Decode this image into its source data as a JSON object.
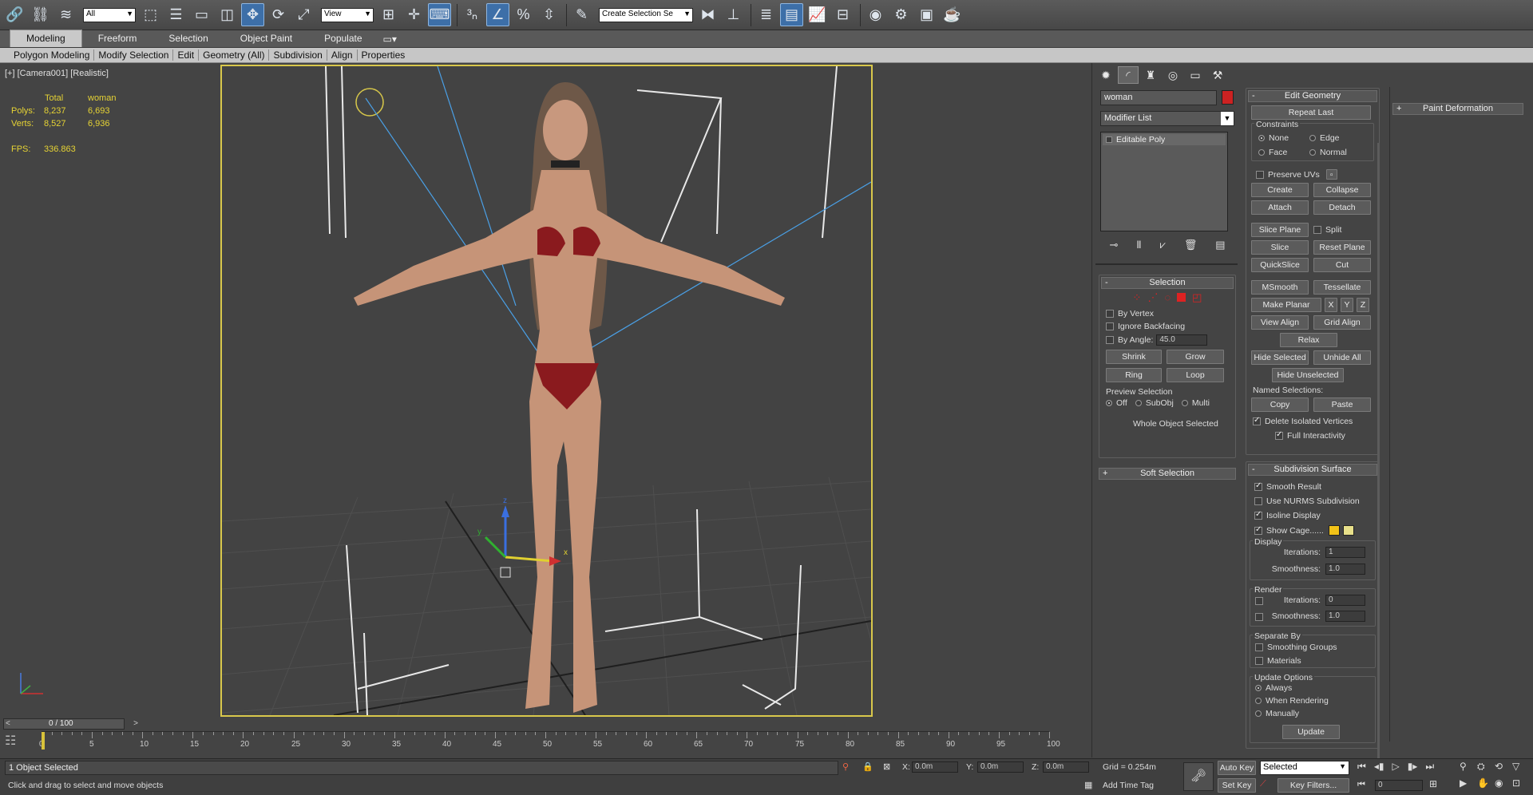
{
  "toolbar": {
    "selection_filter": "All",
    "ref_coord": "View",
    "named_selection_placeholder": "Create Selection Se",
    "icons": [
      "link-icon",
      "unlink-icon",
      "bind-spacewarp-icon",
      "select-object-icon",
      "select-by-name-icon",
      "rect-region-icon",
      "window-crossing-icon",
      "move-icon",
      "rotate-icon",
      "scale-icon",
      "pivot-icon",
      "snap-3d-icon",
      "angle-snap-icon",
      "percent-snap-icon",
      "spinner-snap-icon",
      "edit-named-sel-icon",
      "mirror-icon",
      "align-icon",
      "layers-icon",
      "ribbon-icon",
      "curve-editor-icon",
      "schematic-icon",
      "material-editor-icon",
      "render-setup-icon",
      "render-frame-icon",
      "render-icon"
    ]
  },
  "ribbon": {
    "tabs": [
      "Modeling",
      "Freeform",
      "Selection",
      "Object Paint",
      "Populate"
    ],
    "active_tab": "Modeling",
    "subbar": [
      "Polygon Modeling",
      "Modify Selection",
      "Edit",
      "Geometry (All)",
      "Subdivision",
      "Align",
      "Properties"
    ]
  },
  "viewport": {
    "label": "[+] [Camera001] [Realistic]",
    "stats": {
      "header_total": "Total",
      "header_obj": "woman",
      "polys_label": "Polys:",
      "polys_total": "8,237",
      "polys_obj": "6,693",
      "verts_label": "Verts:",
      "verts_total": "8,527",
      "verts_obj": "6,936",
      "fps_label": "FPS:",
      "fps": "336.863"
    },
    "gizmo": {
      "x": "x",
      "y": "y",
      "z": "z"
    }
  },
  "cmd": {
    "object_name": "woman",
    "object_color": "#cc2222",
    "modifier_list": "Modifier List",
    "stack": [
      "Editable Poly"
    ],
    "selection": {
      "title": "Selection",
      "by_vertex": "By Vertex",
      "ignore_backfacing": "Ignore Backfacing",
      "by_angle": "By Angle:",
      "angle_value": "45.0",
      "shrink": "Shrink",
      "grow": "Grow",
      "ring": "Ring",
      "loop": "Loop",
      "preview_selection": "Preview Selection",
      "preview_opts": [
        "Off",
        "SubObj",
        "Multi"
      ],
      "status": "Whole Object Selected"
    },
    "soft_selection": "Soft Selection",
    "edit_geometry": {
      "title": "Edit Geometry",
      "repeat_last": "Repeat Last",
      "constraints": "Constraints",
      "c_none": "None",
      "c_edge": "Edge",
      "c_face": "Face",
      "c_normal": "Normal",
      "preserve_uvs": "Preserve UVs",
      "create": "Create",
      "collapse": "Collapse",
      "attach": "Attach",
      "detach": "Detach",
      "slice_plane": "Slice Plane",
      "split": "Split",
      "slice": "Slice",
      "reset_plane": "Reset Plane",
      "quickslice": "QuickSlice",
      "cut": "Cut",
      "msmooth": "MSmooth",
      "tessellate": "Tessellate",
      "make_planar": "Make Planar",
      "x": "X",
      "y": "Y",
      "z": "Z",
      "view_align": "View Align",
      "grid_align": "Grid Align",
      "relax": "Relax",
      "hide_selected": "Hide Selected",
      "unhide_all": "Unhide All",
      "hide_unselected": "Hide Unselected",
      "named_selections": "Named Selections:",
      "copy": "Copy",
      "paste": "Paste",
      "delete_isolated": "Delete Isolated Vertices",
      "full_interactivity": "Full Interactivity"
    },
    "subdivision": {
      "title": "Subdivision Surface",
      "smooth_result": "Smooth Result",
      "use_nurms": "Use NURMS Subdivision",
      "isoline": "Isoline Display",
      "show_cage": "Show Cage......",
      "cage_color1": "#f2c318",
      "cage_color2": "#e8e08a",
      "display": "Display",
      "iterations": "Iterations:",
      "iter_val": "1",
      "smoothness": "Smoothness:",
      "smooth_val": "1.0",
      "render": "Render",
      "r_iter_val": "0",
      "r_smooth_val": "1.0",
      "separate_by": "Separate By",
      "smoothing_groups": "Smoothing Groups",
      "materials": "Materials",
      "update_options": "Update Options",
      "always": "Always",
      "when_rendering": "When Rendering",
      "manually": "Manually",
      "update": "Update"
    },
    "paint_deformation": "Paint Deformation"
  },
  "timeline": {
    "frame": "0 / 100",
    "ticks": [
      "0",
      "5",
      "10",
      "15",
      "20",
      "25",
      "30",
      "35",
      "40",
      "45",
      "50",
      "55",
      "60",
      "65",
      "70",
      "75",
      "80",
      "85",
      "90",
      "95",
      "100"
    ]
  },
  "status": {
    "selected": "1 Object Selected",
    "prompt": "Click and drag to select and move objects",
    "x_label": "X:",
    "x_val": "0.0m",
    "y_label": "Y:",
    "y_val": "0.0m",
    "z_label": "Z:",
    "z_val": "0.0m",
    "grid": "Grid = 0.254m",
    "add_time_tag": "Add Time Tag",
    "auto_key": "Auto Key",
    "set_key": "Set Key",
    "key_mode": "Selected",
    "key_filters": "Key Filters...",
    "frame_field": "0"
  }
}
